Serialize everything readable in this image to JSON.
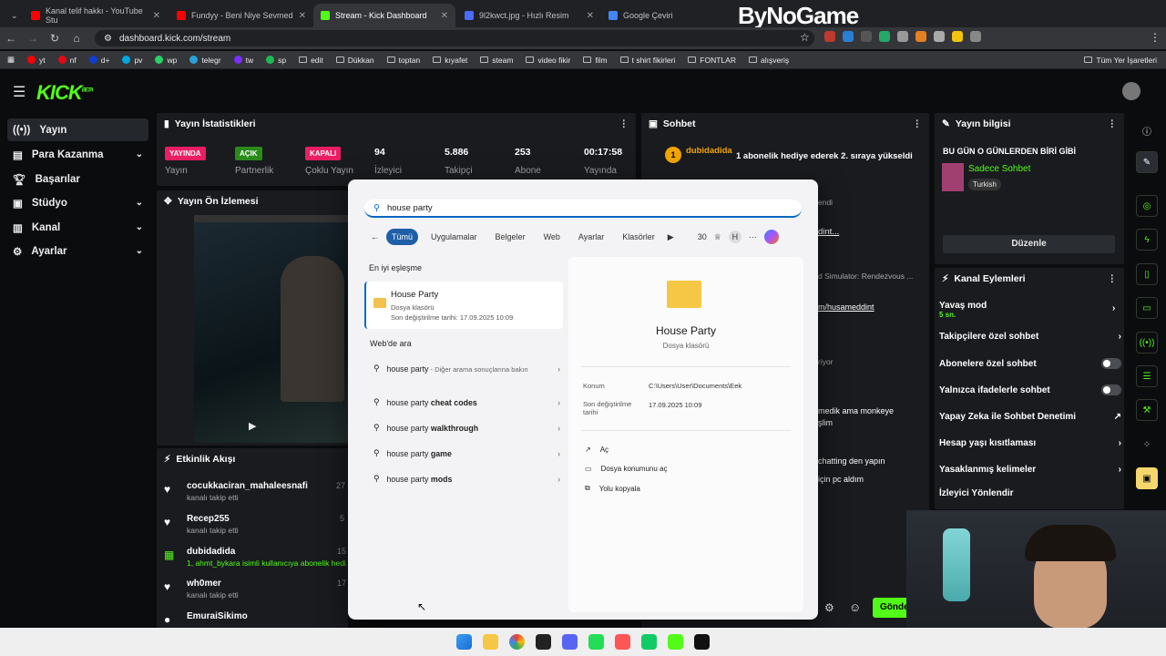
{
  "browser": {
    "tabs": [
      {
        "title": "Kanal telif hakkı - YouTube Stu",
        "color": "#ff0000"
      },
      {
        "title": "Fundyy - Beni Niye Sevmed",
        "color": "#ff0000"
      },
      {
        "title": "Stream - Kick Dashboard",
        "color": "#53fc18"
      },
      {
        "title": "9l2kwct.jpg - Hızlı Resim",
        "color": "#4a6cff"
      },
      {
        "title": "Google Çeviri",
        "color": "#4285f4"
      }
    ],
    "url": "dashboard.kick.com/stream",
    "overlay_brand": "ByNoGame",
    "bookmarks": [
      "yt",
      "nf",
      "d+",
      "pv",
      "wp",
      "telegr",
      "tw",
      "sp",
      "edit",
      "Dükkan",
      "toptan",
      "kıyafet",
      "steam",
      "video fikir",
      "film",
      "t shirt fikirleri",
      "FONTLAR",
      "alışveriş"
    ],
    "all_bookmarks": "Tüm Yer İşaretleri"
  },
  "kick": {
    "logo": "KICK",
    "logo_tag": "BETA",
    "sidebar": [
      "Yayın",
      "Para Kazanma",
      "Başarılar",
      "Stüdyo",
      "Kanal",
      "Ayarlar"
    ],
    "stats": {
      "title": "Yayın İstatistikleri",
      "items": [
        {
          "badge": "YAYINDA",
          "label": "Yayın",
          "badge_color": "#e91e63"
        },
        {
          "badge": "AÇIK",
          "label": "Partnerlik",
          "badge_color": "#2a8a1a"
        },
        {
          "badge": "KAPALI",
          "label": "Çoklu Yayın",
          "badge_color": "#e91e63"
        },
        {
          "value": "94",
          "label": "İzleyici"
        },
        {
          "value": "5.886",
          "label": "Takipçi"
        },
        {
          "value": "253",
          "label": "Abone"
        },
        {
          "value": "00:17:58",
          "label": "Yayında"
        }
      ]
    },
    "preview_title": "Yayın Ön İzlemesi",
    "events": {
      "title": "Etkinlik Akışı",
      "items": [
        {
          "name": "cocukkaciran_mahaleesnafi",
          "sub": "kanalı takip etti",
          "time": "27"
        },
        {
          "name": "Recep255",
          "sub": "kanalı takip etti",
          "time": "5"
        },
        {
          "name": "dubidadida",
          "sub": "1, ahmt_bykara isimli kullanıcıya abonelik hedi",
          "time": "15"
        },
        {
          "name": "wh0mer",
          "sub": "kanalı takip etti",
          "time": "17"
        },
        {
          "name": "EmuraiSikimo",
          "sub": "",
          "time": ""
        }
      ]
    },
    "chat": {
      "title": "Sohbet",
      "gift_user": "dubidadida",
      "gift_count": "1",
      "gift_msg": "1 abonelik hediye ederek 2. sıraya yükseldi",
      "snippets": [
        "endi",
        "dint...",
        "d Simulator: Rendezvous ...",
        "m/husameddint",
        "riyor",
        "medik ama monkeye",
        "şlim",
        "chatting den yapın",
        "için pc aldım"
      ],
      "send": "Gönde"
    },
    "info": {
      "title": "Yayın bilgisi",
      "stream_title": "BU GÜN O GÜNLERDEN BİRİ GİBİ",
      "category": "Sadece Sohbet",
      "language": "Turkish",
      "edit": "Düzenle"
    },
    "actions": {
      "title": "Kanal Eylemleri",
      "items": [
        {
          "label": "Yavaş mod",
          "sub": "5 sn.",
          "ctrl": "chevron"
        },
        {
          "label": "Takipçilere özel sohbet",
          "ctrl": "chevron"
        },
        {
          "label": "Abonelere özel sohbet",
          "ctrl": "toggle"
        },
        {
          "label": "Yalnızca ifadelerle sohbet",
          "ctrl": "toggle"
        },
        {
          "label": "Yapay Zeka ile Sohbet Denetimi",
          "ctrl": "link"
        },
        {
          "label": "Hesap yaşı kısıtlaması",
          "ctrl": "chevron"
        },
        {
          "label": "Yasaklanmış kelimeler",
          "ctrl": "chevron"
        },
        {
          "label": "İzleyici Yönlendir",
          "ctrl": "none"
        }
      ]
    }
  },
  "search": {
    "query": "house party",
    "filters": [
      "Tümü",
      "Uygulamalar",
      "Belgeler",
      "Web",
      "Ayarlar",
      "Klasörler"
    ],
    "points": "30",
    "avatar_letter": "H",
    "best_match_label": "En iyi eşleşme",
    "best": {
      "name": "House Party",
      "type": "Dosya klasörü",
      "modified": "Son değiştirilme tarihi: 17.09.2025 10:09"
    },
    "web_label": "Web'de ara",
    "web": [
      {
        "main": "house party",
        "bold": "",
        "extra": " - Diğer arama sonuçlarına bakın"
      },
      {
        "main": "house party ",
        "bold": "cheat codes",
        "extra": ""
      },
      {
        "main": "house party ",
        "bold": "walkthrough",
        "extra": ""
      },
      {
        "main": "house party ",
        "bold": "game",
        "extra": ""
      },
      {
        "main": "house party ",
        "bold": "mods",
        "extra": ""
      }
    ],
    "detail": {
      "name": "House Party",
      "type": "Dosya klasörü",
      "loc_label": "Konum",
      "loc_value": "C:\\Users\\User\\Documents\\Eek",
      "mod_label": "Son değiştirilme tarihi",
      "mod_value": "17.09.2025 10:09",
      "actions": [
        "Aç",
        "Dosya konumunu aç",
        "Yolu kopyala"
      ]
    }
  }
}
